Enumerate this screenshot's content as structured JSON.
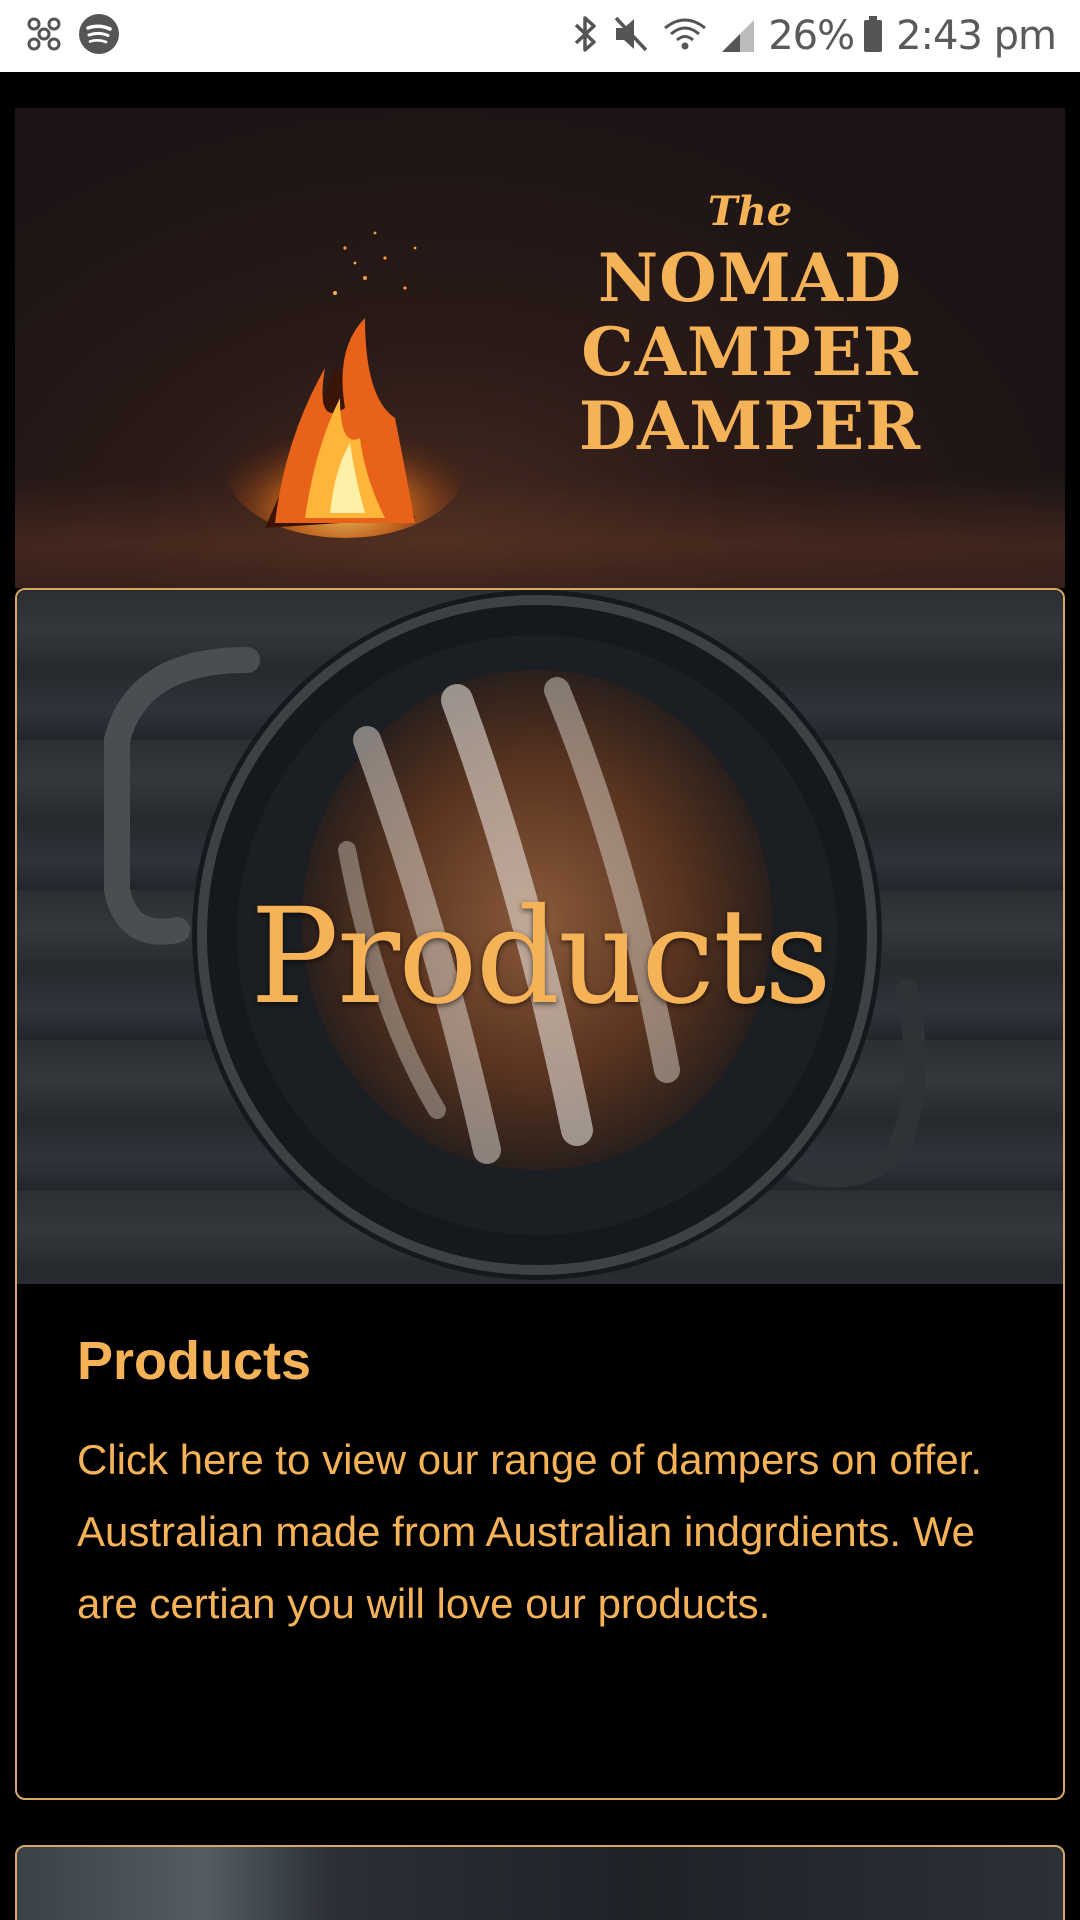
{
  "status_bar": {
    "battery": "26%",
    "time": "2:43 pm",
    "icons": [
      "pinwheel-icon",
      "spotify-icon",
      "bluetooth-icon",
      "mute-icon",
      "wifi-icon",
      "signal-icon",
      "battery-icon"
    ]
  },
  "hero": {
    "brand_the": "The",
    "brand_lines": [
      "NOMAD",
      "CAMPER",
      "DAMPER"
    ]
  },
  "product_card": {
    "image_text": "Products",
    "title": "Products",
    "description": "Click here to view our range of dampers on offer. Australian made from Australian indgrdients. We are certian you will love our products."
  },
  "colors": {
    "accent": "#f6b256",
    "border": "#d9a860",
    "background": "#000000"
  }
}
